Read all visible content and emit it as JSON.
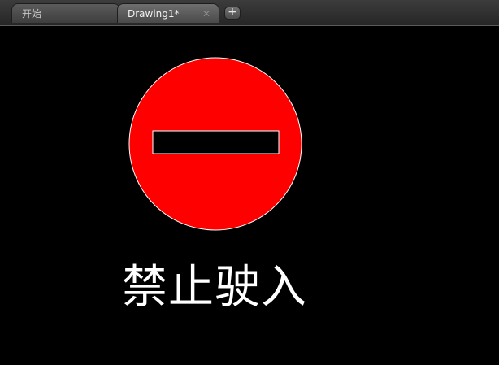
{
  "tabs": {
    "start_label": "开始",
    "active_label": "Drawing1*",
    "close_glyph": "✕",
    "add_glyph": "+"
  },
  "drawing": {
    "caption": "禁止驶入",
    "sign_fill_color": "#ff0000",
    "sign_outline_color": "#ffffff",
    "bar_fill_color": "#000000",
    "background_color": "#000000"
  }
}
